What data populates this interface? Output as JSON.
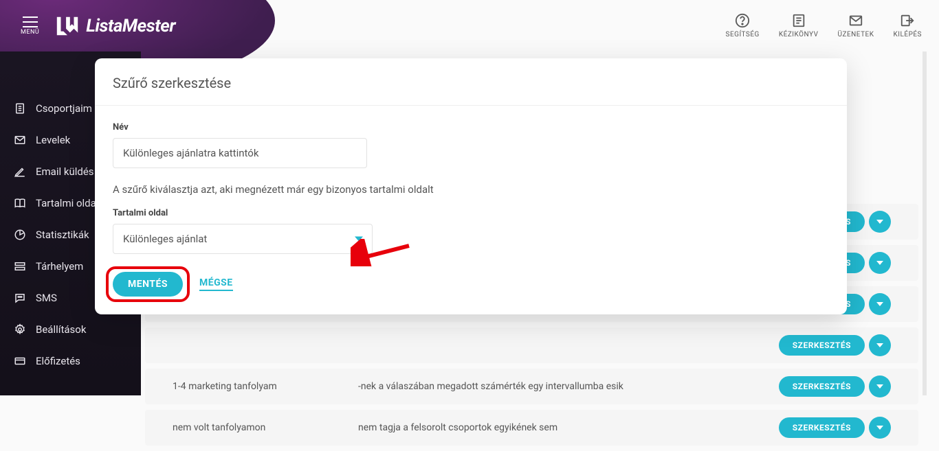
{
  "header": {
    "menu_label": "MENÜ",
    "brand": "ListaMester",
    "right": [
      {
        "key": "help",
        "label": "SEGÍTSÉG"
      },
      {
        "key": "guide",
        "label": "KÉZIKÖNYV"
      },
      {
        "key": "messages",
        "label": "ÜZENETEK"
      },
      {
        "key": "logout",
        "label": "KILÉPÉS"
      }
    ]
  },
  "sidebar": {
    "items": [
      {
        "key": "groups",
        "label": "Csoportjaim"
      },
      {
        "key": "letters",
        "label": "Levelek"
      },
      {
        "key": "send",
        "label": "Email küldés"
      },
      {
        "key": "content",
        "label": "Tartalmi oldal"
      },
      {
        "key": "stats",
        "label": "Statisztikák"
      },
      {
        "key": "storage",
        "label": "Tárhelyem"
      },
      {
        "key": "sms",
        "label": "SMS"
      },
      {
        "key": "settings",
        "label": "Beállítások"
      },
      {
        "key": "subscription",
        "label": "Előfizetés"
      }
    ]
  },
  "bg_rows": [
    {
      "name": "",
      "desc": ""
    },
    {
      "name": "",
      "desc": ""
    },
    {
      "name": "",
      "desc": ""
    },
    {
      "name": "",
      "desc": ""
    },
    {
      "name": "1-4 marketing tanfolyam",
      "desc": "-nek a válaszában megadott számérték egy intervallumba esik"
    },
    {
      "name": "nem volt tanfolyamon",
      "desc": "nem tagja a felsorolt csoportok egyikének sem"
    }
  ],
  "bg_buttons": {
    "edit": "SZERKESZTÉS"
  },
  "modal": {
    "title": "Szűrő szerkesztése",
    "name_label": "Név",
    "name_value": "Különleges ajánlatra kattintók",
    "description": "A szűrő kiválasztja azt, aki megnézett már egy bizonyos tartalmi oldalt",
    "select_label": "Tartalmi oldal",
    "select_value": "Különleges ajánlat",
    "save": "MENTÉS",
    "cancel": "MÉGSE"
  }
}
